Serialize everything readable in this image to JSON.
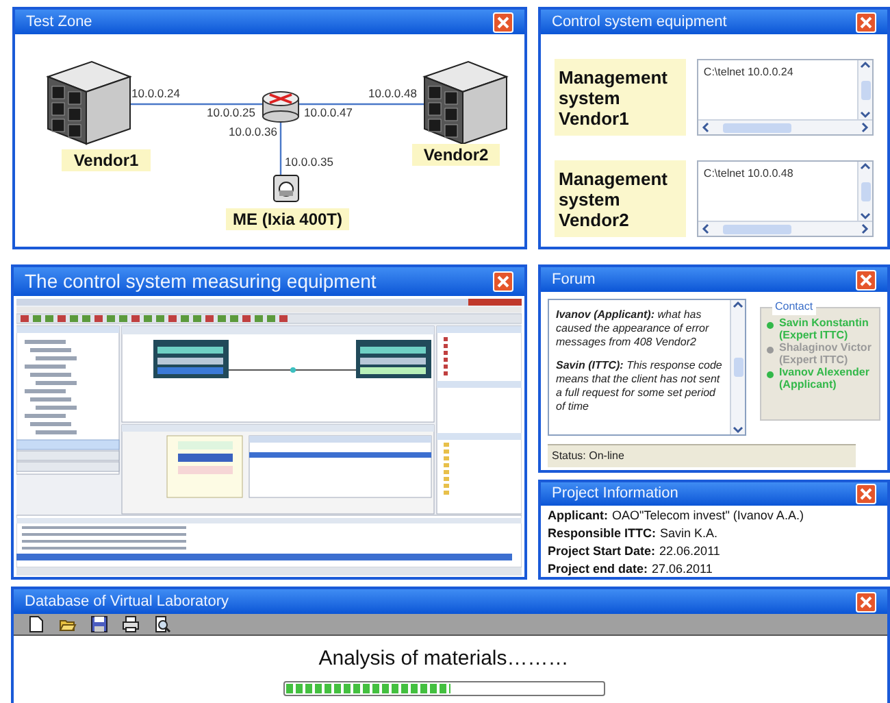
{
  "test_zone": {
    "title": "Test Zone",
    "nodes": [
      {
        "kind": "server",
        "label": "Vendor1"
      },
      {
        "kind": "server",
        "label": "Vendor2"
      },
      {
        "kind": "tester",
        "label": "ME (Ixia 400T)"
      }
    ],
    "ip_labels": [
      "10.0.0.24",
      "10.0.0.25",
      "10.0.0.47",
      "10.0.0.48",
      "10.0.0.36",
      "10.0.0.35"
    ]
  },
  "control": {
    "title": "Control system equipment",
    "systems": [
      {
        "label": "Management system Vendor1",
        "console": "C:\\telnet 10.0.0.24"
      },
      {
        "label": "Management system Vendor2",
        "console": "C:\\telnet 10.0.0.48"
      }
    ]
  },
  "measuring": {
    "title": "The control system measuring equipment"
  },
  "forum": {
    "title": "Forum",
    "messages": [
      "**Ivanov (Applicant):** what has caused the appearance of error messages from 408 Vendor2",
      "**Savin (ITTC):** This response code means that the client has not sent a full request for some set period of time"
    ],
    "contact_legend": "Contact",
    "contacts": [
      {
        "name": "Savin Konstantin (Expert  ITTC)",
        "online": true
      },
      {
        "name": "Shalaginov Victor (Expert ITTC)",
        "online": false
      },
      {
        "name": "Ivanov Alexender (Applicant)",
        "online": true
      }
    ],
    "status": "Status: On-line"
  },
  "project": {
    "title": "Project Information",
    "fields": [
      {
        "label": "Applicant:",
        "value": "OAO\"Telecom invest\" (Ivanov A.A.)"
      },
      {
        "label": "Responsible ITTC:",
        "value": "Savin K.A."
      },
      {
        "label": "Project Start Date:",
        "value": "22.06.2011"
      },
      {
        "label": "Project end date:",
        "value": "27.06.2011"
      }
    ]
  },
  "database": {
    "title": "Database of Virtual Laboratory",
    "message": "Analysis of materials………",
    "progress": {
      "level": 0.52
    }
  }
}
